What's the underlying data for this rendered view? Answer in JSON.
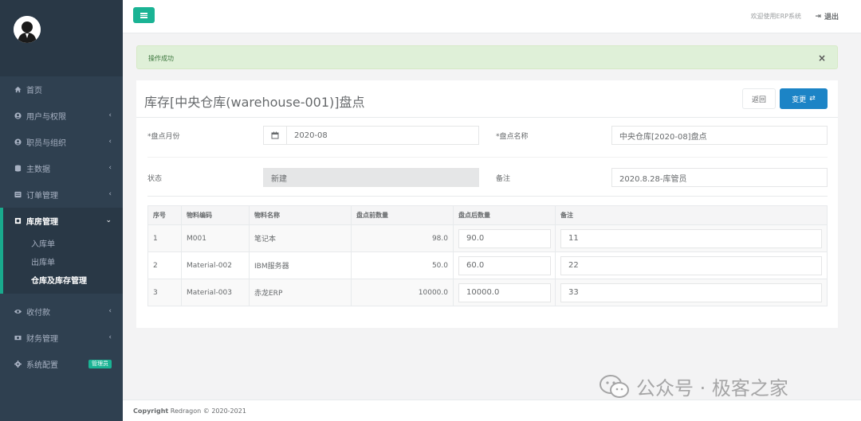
{
  "sidebar": {
    "items": [
      {
        "label": "首页",
        "icon": "home-icon"
      },
      {
        "label": "用户与权限",
        "icon": "user-circle-icon"
      },
      {
        "label": "职员与组织",
        "icon": "user-badge-icon"
      },
      {
        "label": "主数据",
        "icon": "database-icon"
      },
      {
        "label": "订单管理",
        "icon": "list-icon"
      },
      {
        "label": "库房管理",
        "icon": "warehouse-icon"
      },
      {
        "label": "收付款",
        "icon": "eye-icon"
      },
      {
        "label": "财务管理",
        "icon": "money-icon"
      },
      {
        "label": "系统配置",
        "icon": "gear-icon",
        "badge": "管理员"
      }
    ],
    "submenu": [
      "入库单",
      "出库单",
      "仓库及库存管理"
    ]
  },
  "topbar": {
    "welcome": "欢迎使用ERP系统",
    "logout": "退出"
  },
  "alert": {
    "message": "操作成功",
    "close": "×"
  },
  "panel": {
    "title": "库存[中央仓库(warehouse-001)]盘点",
    "back_label": "返回",
    "change_label": "变更",
    "form": {
      "month_label": "*盘点月份",
      "month_value": "2020-08",
      "name_label": "*盘点名称",
      "name_value": "中央仓库[2020-08]盘点",
      "status_label": "状态",
      "status_value": "新建",
      "remark_label": "备注",
      "remark_value": "2020.8.28-库管员"
    },
    "table": {
      "headers": [
        "序号",
        "物料编码",
        "物料名称",
        "盘点前数量",
        "盘点后数量",
        "备注"
      ],
      "rows": [
        {
          "no": "1",
          "code": "M001",
          "name": "笔记本",
          "before": "98.0",
          "after": "90.0",
          "note": "11"
        },
        {
          "no": "2",
          "code": "Material-002",
          "name": "IBM服务器",
          "before": "50.0",
          "after": "60.0",
          "note": "22"
        },
        {
          "no": "3",
          "code": "Material-003",
          "name": "赤龙ERP",
          "before": "10000.0",
          "after": "10000.0",
          "note": "33"
        }
      ]
    }
  },
  "footer": {
    "bold": "Copyright",
    "text": " Redragon © 2020-2021"
  },
  "watermark": "公众号 · 极客之家",
  "colors": {
    "sidebar": "#2f4050",
    "accent": "#1ab394",
    "primary": "#1c84c6",
    "alert_bg": "#dff0d8"
  }
}
